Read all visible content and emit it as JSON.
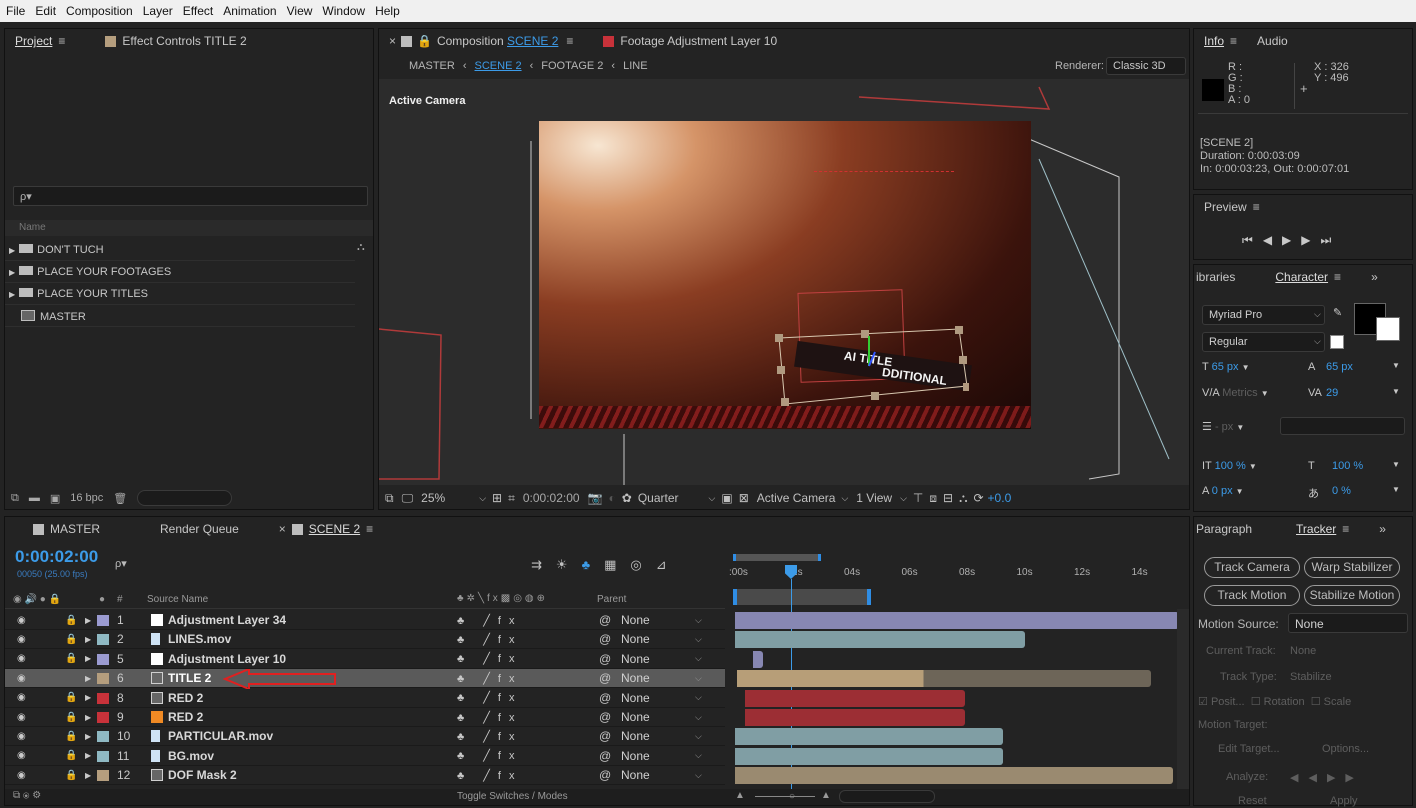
{
  "menu": [
    "File",
    "Edit",
    "Composition",
    "Layer",
    "Effect",
    "Animation",
    "View",
    "Window",
    "Help"
  ],
  "project": {
    "tab": "Project",
    "tab2": "Effect Controls TITLE 2",
    "search_placeholder": "ρ▾",
    "col_name": "Name",
    "items": [
      "DON'T TUCH",
      "PLACE YOUR FOOTAGES",
      "PLACE YOUR TITLES",
      "MASTER"
    ],
    "bpc": "16 bpc"
  },
  "comp": {
    "tab_prefix": "Composition",
    "tab_name": "SCENE 2",
    "tab2": "Footage Adjustment Layer 10",
    "crumbs": [
      "MASTER",
      "SCENE 2",
      "FOOTAGE 2",
      "LINE"
    ],
    "renderer_label": "Renderer:",
    "renderer_value": "Classic 3D",
    "active_camera": "Active Camera",
    "zoom": "25%",
    "time": "0:00:02:00",
    "quality": "Quarter",
    "camera": "Active Camera",
    "views": "1 View",
    "exposure": "+0.0",
    "title_line1": "AI TITLE",
    "title_line2": "DDITIONAL"
  },
  "info": {
    "tab": "Info",
    "tab2": "Audio",
    "r": "R :",
    "g": "G :",
    "b": "B :",
    "a": "A : 0",
    "x": "X : 326",
    "y": "Y : 496",
    "scene": "[SCENE 2]",
    "duration": "Duration: 0:00:03:09",
    "inout": "In: 0:00:03:23, Out: 0:00:07:01"
  },
  "preview": {
    "tab": "Preview"
  },
  "character": {
    "tab0": "ibraries",
    "tab": "Character",
    "font": "Myriad Pro",
    "style": "Regular",
    "size": "65 px",
    "leading": "65 px",
    "kerning": "Metrics",
    "tracking": "29",
    "stroke": "- px",
    "vscale": "100 %",
    "hscale": "100 %",
    "baseline": "0 px",
    "tsume": "0 %"
  },
  "tracker": {
    "tab0": "Paragraph",
    "tab": "Tracker",
    "btn_track_camera": "Track Camera",
    "btn_warp": "Warp Stabilizer",
    "btn_track_motion": "Track Motion",
    "btn_stab_motion": "Stabilize Motion",
    "motion_source_label": "Motion Source:",
    "motion_source_value": "None",
    "current_track": "Current Track:",
    "current_track_value": "None",
    "track_type": "Track Type:",
    "track_type_value": "Stabilize",
    "posit": "Posit...",
    "rotation": "Rotation",
    "scale": "Scale",
    "motion_target": "Motion Target:",
    "edit_target": "Edit Target...",
    "options": "Options...",
    "analyze": "Analyze:",
    "reset": "Reset",
    "apply": "Apply"
  },
  "timeline": {
    "tabs": [
      "MASTER",
      "Render Queue",
      "SCENE 2"
    ],
    "timecode": "0:00:02:00",
    "fps": "00050 (25.00 fps)",
    "col_hash": "#",
    "col_source": "Source Name",
    "col_parent": "Parent",
    "ruler": [
      ":00s",
      "02s",
      "04s",
      "06s",
      "08s",
      "10s",
      "12s",
      "14s"
    ],
    "toggle": "Toggle Switches / Modes",
    "layers": [
      {
        "num": "1",
        "name": "Adjustment Layer 34",
        "label": "#9a9ad0",
        "icon": "solid-white",
        "parent": "None"
      },
      {
        "num": "2",
        "name": "LINES.mov",
        "label": "#8fb9c3",
        "icon": "file",
        "parent": "None"
      },
      {
        "num": "5",
        "name": "Adjustment Layer 10",
        "label": "#9a9ad0",
        "icon": "solid-white",
        "parent": "None"
      },
      {
        "num": "6",
        "name": "TITLE 2",
        "label": "#b59e7e",
        "icon": "comp",
        "parent": "None"
      },
      {
        "num": "8",
        "name": "RED 2",
        "label": "#c8323a",
        "icon": "comp",
        "parent": "None"
      },
      {
        "num": "9",
        "name": "RED 2",
        "label": "#c8323a",
        "icon": "solid-orange",
        "parent": "None"
      },
      {
        "num": "10",
        "name": "PARTICULAR.mov",
        "label": "#8fb9c3",
        "icon": "file",
        "parent": "None"
      },
      {
        "num": "11",
        "name": "BG.mov",
        "label": "#8fb9c3",
        "icon": "file",
        "parent": "None"
      },
      {
        "num": "12",
        "name": "DOF Mask 2",
        "label": "#b59e7e",
        "icon": "comp",
        "parent": "None"
      }
    ]
  },
  "colors": {
    "accent": "#3c9be8",
    "label_title": "#b59e7e",
    "label_red": "#c8323a",
    "label_lines": "#8fb9c3",
    "label_adj": "#9a9ad0"
  }
}
